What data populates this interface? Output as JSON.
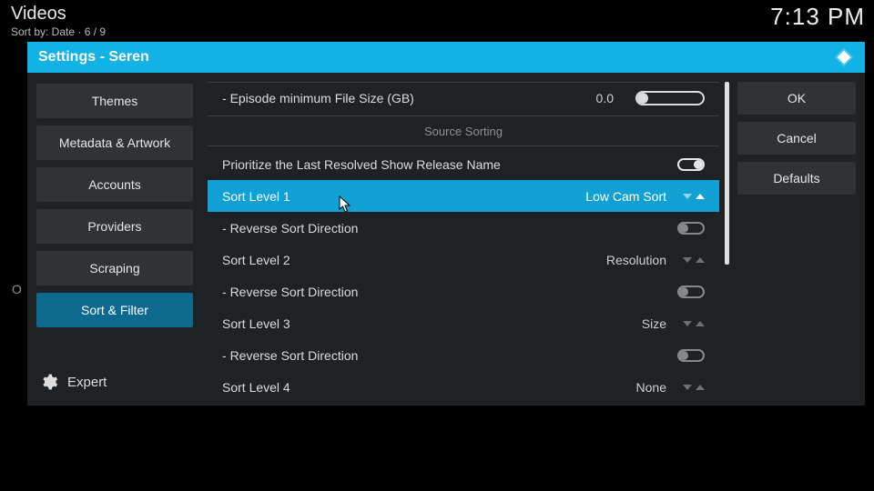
{
  "topbar": {
    "title": "Videos",
    "subtitle": "Sort by: Date  ·  6 / 9",
    "clock": "7:13 PM"
  },
  "dialog": {
    "title": "Settings - Seren"
  },
  "nav": {
    "items": [
      {
        "id": "themes",
        "label": "Themes"
      },
      {
        "id": "metadata",
        "label": "Metadata & Artwork"
      },
      {
        "id": "accounts",
        "label": "Accounts"
      },
      {
        "id": "providers",
        "label": "Providers"
      },
      {
        "id": "scraping",
        "label": "Scraping"
      },
      {
        "id": "sort-filter",
        "label": "Sort & Filter"
      }
    ],
    "active": "sort-filter",
    "level_label": "Expert"
  },
  "buttons": {
    "ok": "OK",
    "cancel": "Cancel",
    "defaults": "Defaults"
  },
  "settings": {
    "ep_min_size": {
      "label": "Episode minimum File Size (GB)",
      "value": "0.0"
    },
    "section": "Source Sorting",
    "prioritize": {
      "label": "Prioritize the Last Resolved Show Release Name",
      "on": true
    },
    "sort1": {
      "label": "Sort Level 1",
      "value": "Low Cam Sort"
    },
    "rev1": {
      "label": "Reverse Sort Direction",
      "on": false
    },
    "sort2": {
      "label": "Sort Level 2",
      "value": "Resolution"
    },
    "rev2": {
      "label": "Reverse Sort Direction",
      "on": false
    },
    "sort3": {
      "label": "Sort Level 3",
      "value": "Size"
    },
    "rev3": {
      "label": "Reverse Sort Direction",
      "on": false
    },
    "sort4": {
      "label": "Sort Level 4",
      "value": "None"
    }
  }
}
